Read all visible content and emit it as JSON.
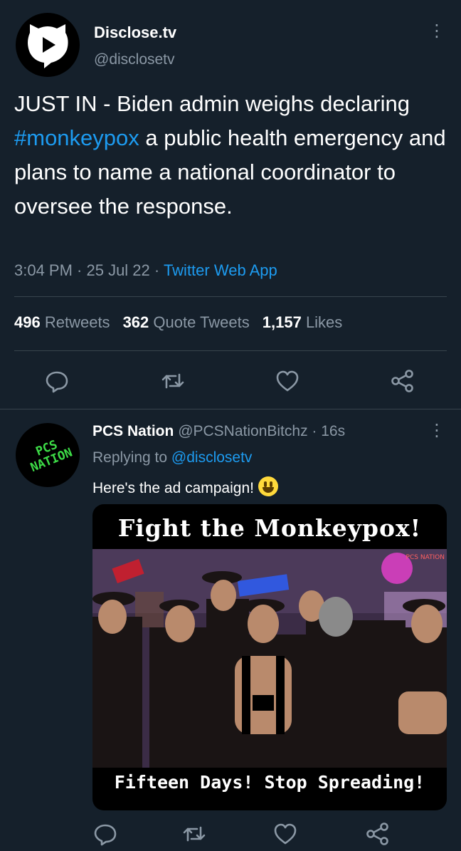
{
  "tweet": {
    "author_name": "Disclose.tv",
    "author_handle": "@disclosetv",
    "text_before": "JUST IN - Biden admin weighs declaring ",
    "hashtag": "#monkeypox",
    "text_after": " a public health emergency and plans to name a national coordinator to oversee the response.",
    "time": "3:04 PM · 25 Jul 22 · ",
    "source": "Twitter Web App",
    "stats": {
      "retweets_count": "496",
      "retweets_label": "Retweets",
      "quotes_count": "362",
      "quotes_label": "Quote Tweets",
      "likes_count": "1,157",
      "likes_label": "Likes"
    },
    "more_icon": "⋮"
  },
  "reply": {
    "author_name": "PCS Nation",
    "author_handle_time": "@PCSNationBitchz · 16s",
    "replying_prefix": "Replying to ",
    "replying_to": "@disclosetv",
    "text": "Here's the ad campaign!",
    "avatar_text": "PCS NATION",
    "more_icon": "⋮",
    "media": {
      "top_caption": "Fight the Monkeypox!",
      "bottom_caption": "Fifteen Days! Stop Spreading!",
      "watermark": "PCS NATION"
    }
  },
  "colors": {
    "background": "#15202b",
    "accent": "#1d9bf0",
    "muted": "#8b98a5",
    "divider": "#38444d"
  },
  "icons": [
    "reply-icon",
    "retweet-icon",
    "like-icon",
    "share-icon"
  ]
}
